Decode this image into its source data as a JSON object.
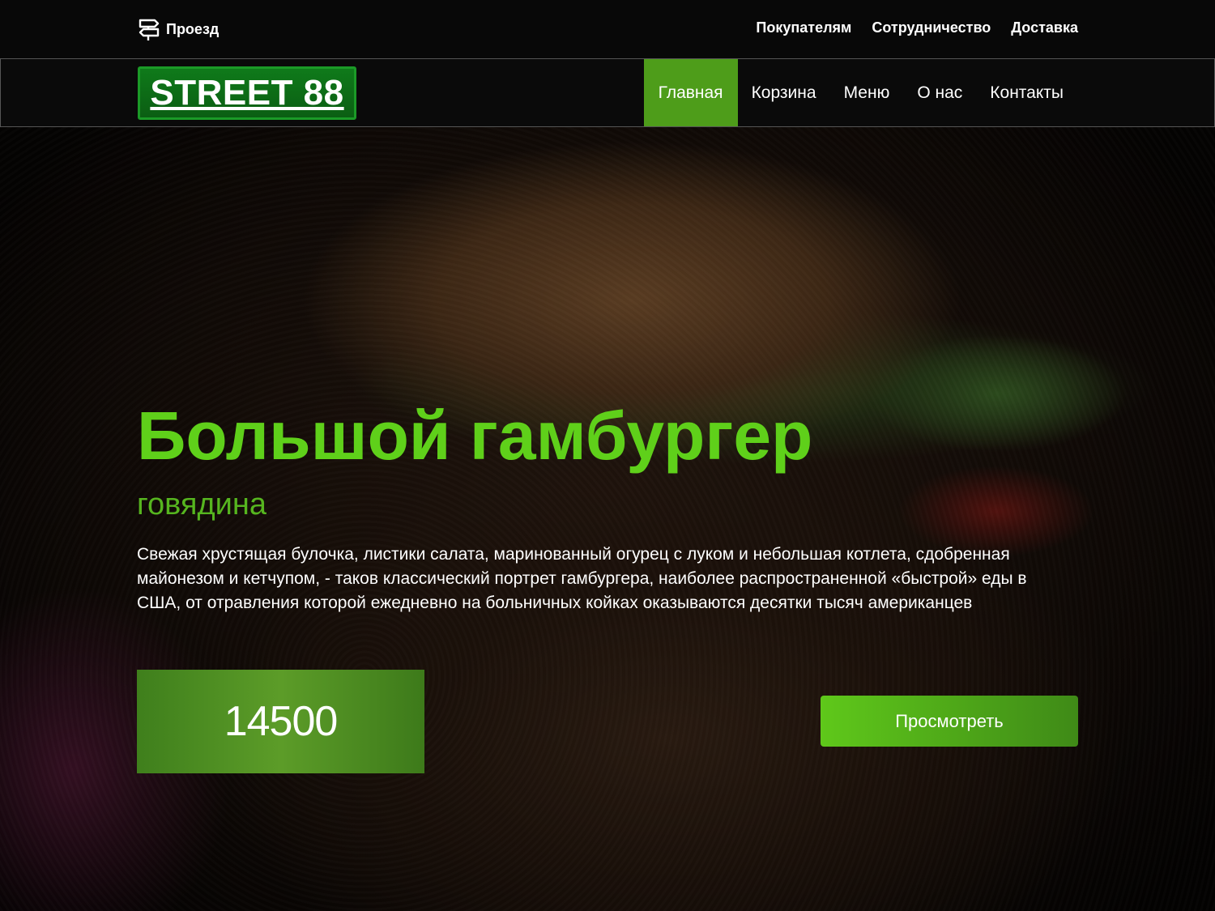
{
  "topbar": {
    "directions_label": "Проезд",
    "links": [
      "Покупателям",
      "Сотрудничество",
      "Доставка"
    ]
  },
  "navbar": {
    "logo": "STREET 88",
    "items": [
      {
        "label": "Главная",
        "active": true
      },
      {
        "label": "Корзина",
        "active": false
      },
      {
        "label": "Меню",
        "active": false
      },
      {
        "label": "О нас",
        "active": false
      },
      {
        "label": "Контакты",
        "active": false
      }
    ]
  },
  "hero": {
    "title": "Большой гамбургер",
    "subtitle": "говядина",
    "description": "Свежая хрустящая булочка, листики салата, маринованный огурец с луком и небольшая котлета, сдобренная майонезом и кетчупом, - таков классический портрет гамбургера, наиболее распространенной «быстрой» еды в США, от отравления которой ежедневно на больничных койках оказываются десятки тысяч американцев",
    "price": "14500",
    "view_button": "Просмотреть"
  },
  "icons": {
    "directions": "signpost-icon"
  },
  "colors": {
    "accent_green": "#5fd01a",
    "nav_active": "#4e9d1a",
    "logo_green": "#0f7a1a",
    "topbar_bg": "#080808"
  }
}
